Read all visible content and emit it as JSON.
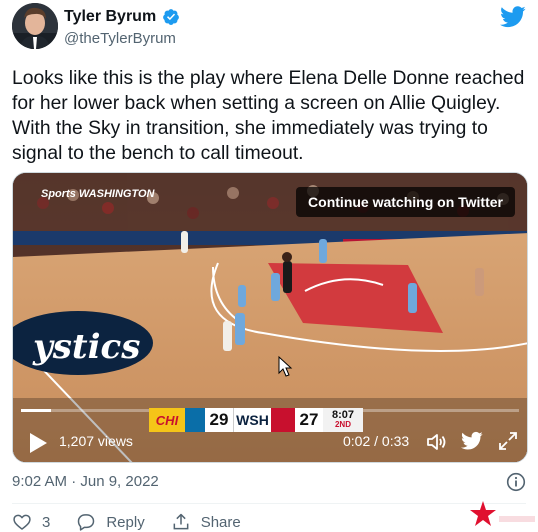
{
  "tweet": {
    "author_name": "Tyler Byrum",
    "author_handle": "@theTylerByrum",
    "text": "Looks like this is the play where Elena Delle Donne reached for her lower back when setting a screen on Allie Quigley. With the Sky in transition, she immediately was trying to signal to the bench to call timeout.",
    "timestamp": "9:02 AM · Jun 9, 2022"
  },
  "video": {
    "continue_label": "Continue watching on Twitter",
    "views": "1,207 views",
    "time": "0:02 / 0:33",
    "progress_fraction": 0.06,
    "broadcaster_logo_text": "Sports WASHINGTON",
    "court_logo_text": "ystics",
    "scorebug": {
      "team1": "CHI",
      "score1": "29",
      "team2": "WSH",
      "score2": "27",
      "clock": "8:07",
      "period": "2ND"
    }
  },
  "actions": {
    "likes_count": "3",
    "reply_label": "Reply",
    "share_label": "Share"
  },
  "icons": [
    "verified-badge-icon",
    "twitter-bird-icon",
    "play-icon",
    "volume-icon",
    "fullscreen-icon",
    "info-icon",
    "heart-icon",
    "reply-icon",
    "share-icon"
  ],
  "colors": {
    "verified": "#1d9bf0",
    "twitter_blue": "#1d9bf0",
    "secondary_text": "#536471",
    "watermark": "#e0102f"
  }
}
